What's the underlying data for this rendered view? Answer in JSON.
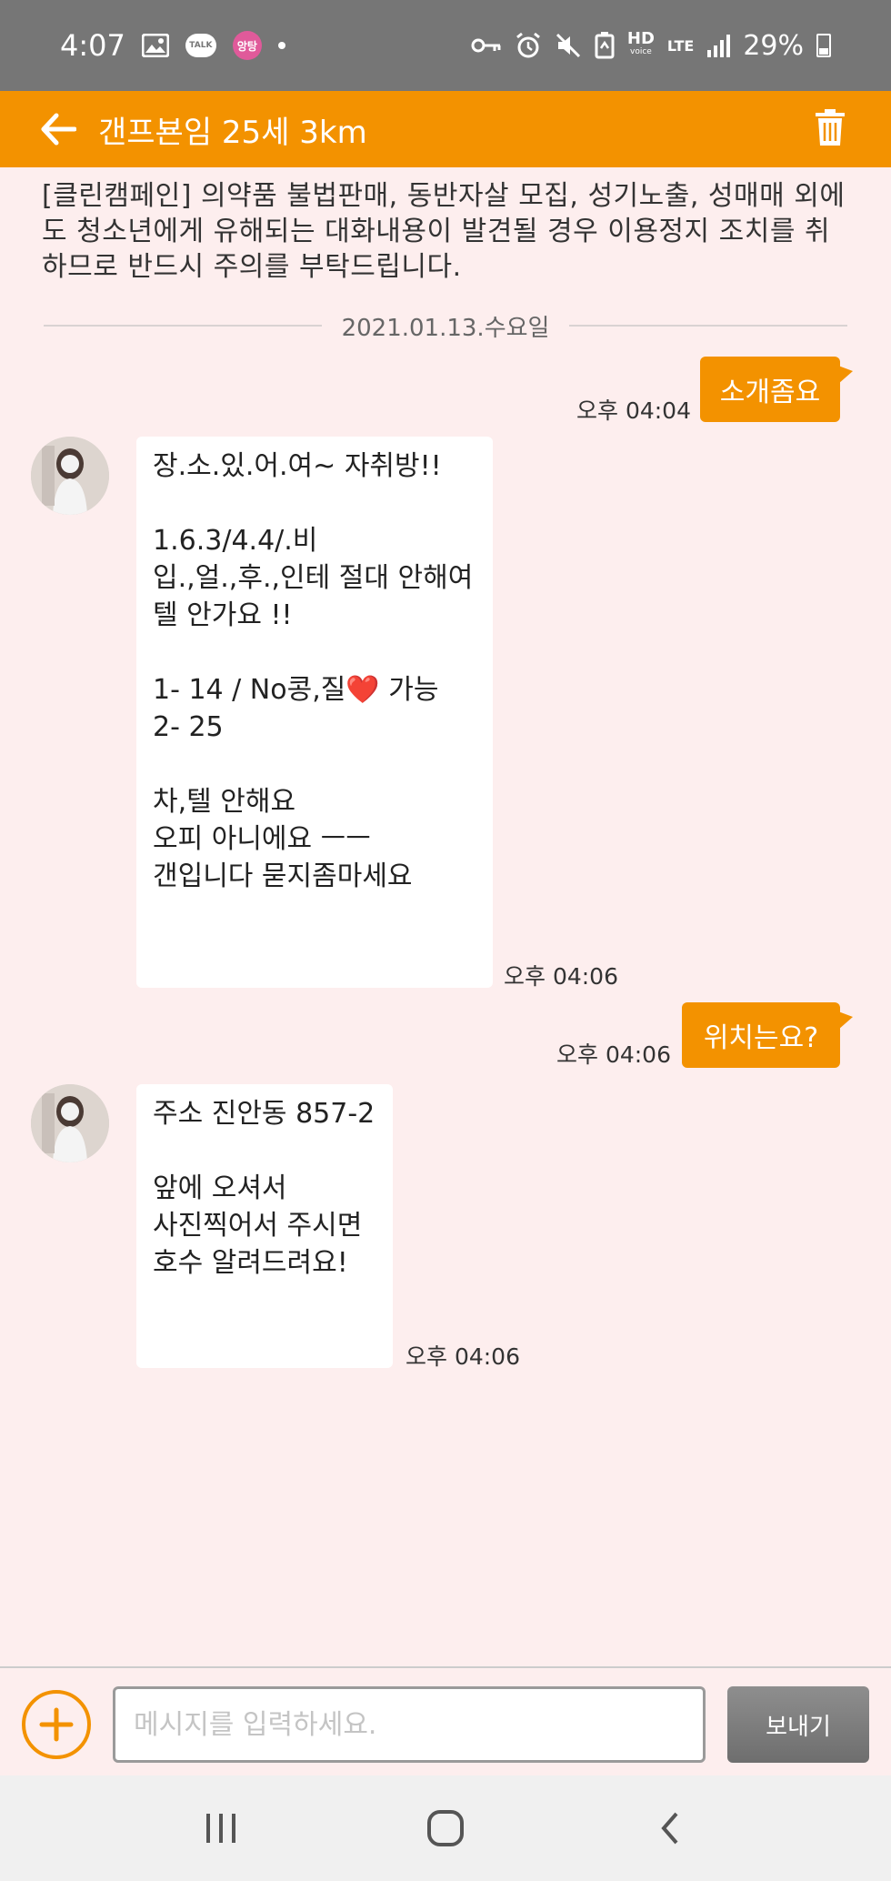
{
  "status_bar": {
    "time": "4:07",
    "talk_label": "TALK",
    "app_badge": "앙탕",
    "hd_label": "HD",
    "voice_label": "voice",
    "lte_label": "LTE",
    "battery": "29%"
  },
  "header": {
    "title": "갠프뵨임 25세 3km",
    "accent_color": "#f39200"
  },
  "notice": "[클린캠페인] 의약품 불법판매, 동반자살 모집, 성기노출, 성매매 외에도 청소년에게 유해되는 대화내용이 발견될 경우 이용정지 조치를 취하므로 반드시 주의를 부탁드립니다.",
  "date_divider": "2021.01.13.수요일",
  "messages": [
    {
      "side": "out",
      "text": "소개좀요",
      "time": "오후 04:04"
    },
    {
      "side": "in",
      "text": "장.소.있.어.여~ 자취방!!\n\n1.6.3/4.4/.비\n입.,얼.,후.,인테 절대 안해여\n텔 안가요 !!\n\n1- 14 / No콩,질❤️ 가능\n2- 25\n\n차,텔 안해요\n오피 아니에요 ㅡㅡ\n갠입니다 묻지좀마세요",
      "time": "오후 04:06"
    },
    {
      "side": "out",
      "text": "위치는요?",
      "time": "오후 04:06"
    },
    {
      "side": "in",
      "text": "주소 진안동 857-2\n\n앞에 오셔서\n사진찍어서 주시면\n호수 알려드려요!",
      "time": "오후 04:06"
    }
  ],
  "input": {
    "placeholder": "메시지를 입력하세요.",
    "value": ""
  },
  "send_label": "보내기"
}
